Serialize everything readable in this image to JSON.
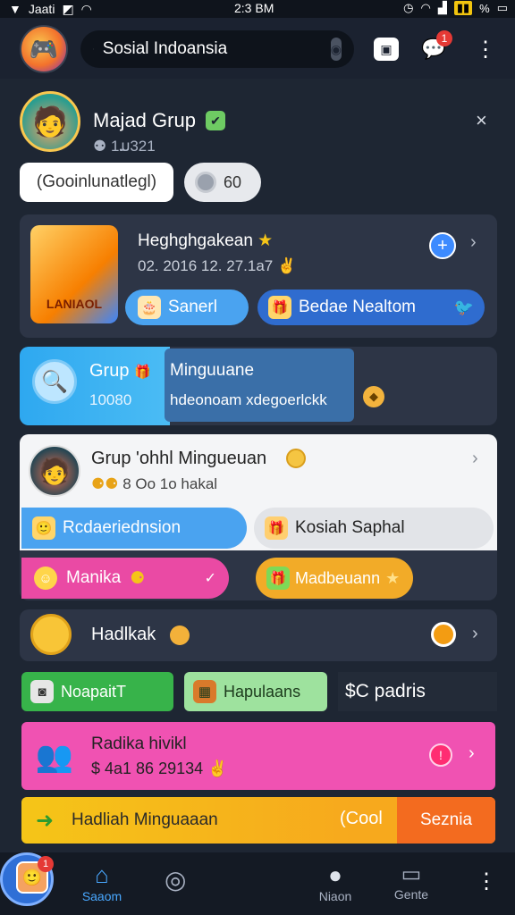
{
  "status_bar": {
    "carrier": "Jaati",
    "time": "2:3 BM",
    "battery": "%"
  },
  "search": {
    "value": "Sosial Indoansia"
  },
  "topbar": {
    "chat_badge": "1"
  },
  "group_header": {
    "title": "Majad Grup",
    "subtitle": "1ມ321",
    "close": "×"
  },
  "pills": {
    "category": "(Gooinlunatlegl)",
    "count": "60"
  },
  "card1": {
    "title": "Heghghgakean",
    "meta": "02. 2016 12. 27.1a7",
    "image_caption": "LANIAOL",
    "btn1": "Sanerl",
    "btn2": "Bedae Nealtom"
  },
  "card2": {
    "label": "Grup",
    "count": "10080",
    "title": "Minguuane",
    "desc": "hdeonoam xdegoerlckk"
  },
  "card3": {
    "title": "Grup 'ohhl Mingueuan",
    "meta": "8 Oo 1o hakal",
    "chip1": "Rcdaeriednsion",
    "chip2": "Kosiah Saphal",
    "chip3": "Manika",
    "chip4": "Madbeuann"
  },
  "card4": {
    "title": "Hadlkak"
  },
  "row5": {
    "a": "NoapaitT",
    "b": "Hapulaans",
    "c": "$C padris"
  },
  "card6": {
    "title": "Radika hivikl",
    "meta": "$ 4a1 86 29134"
  },
  "card7": {
    "title": "Hadliah Minguaaan",
    "mid": "(Cool",
    "button": "Seznia"
  },
  "bottom_nav": {
    "profile_badge": "1",
    "home": "Saaom",
    "chat": "Niaon",
    "gente": "Gente"
  }
}
